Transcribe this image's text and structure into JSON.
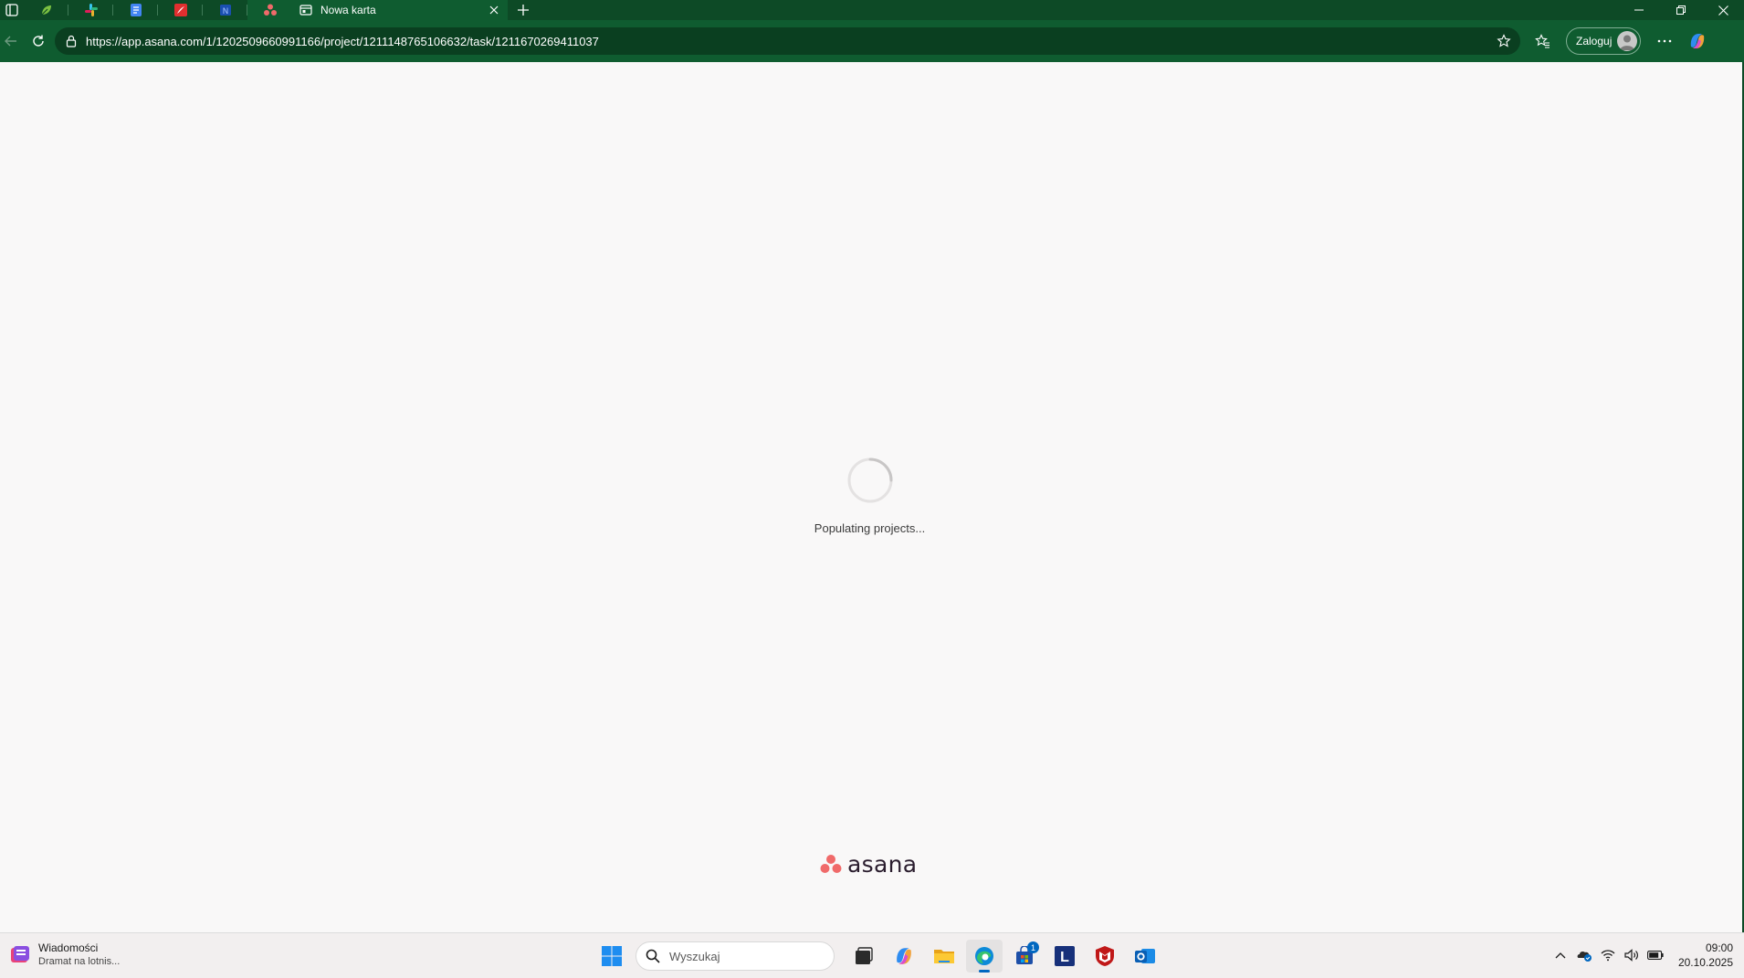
{
  "browser": {
    "active_tab_title": "Nowa karta",
    "url": "https://app.asana.com/1/1202509660991166/project/1211148765106632/task/1211670269411037",
    "login_label": "Zaloguj",
    "pinned_tabs": [
      "app-tab-1",
      "slack-tab",
      "docs-tab",
      "pdf-tab",
      "word-tab",
      "asana-tab"
    ]
  },
  "page": {
    "loading_text": "Populating projects...",
    "logo_text": "asana"
  },
  "taskbar": {
    "widget_title": "Wiadomości",
    "widget_subtitle": "Dramat na lotnis...",
    "search_placeholder": "Wyszukaj",
    "store_badge": "1",
    "time": "09:00",
    "date": "20.10.2025"
  },
  "colors": {
    "browser_frame": "#0d4a26",
    "asana_coral": "#f06a6a",
    "page_bg": "#f9f8f8"
  }
}
